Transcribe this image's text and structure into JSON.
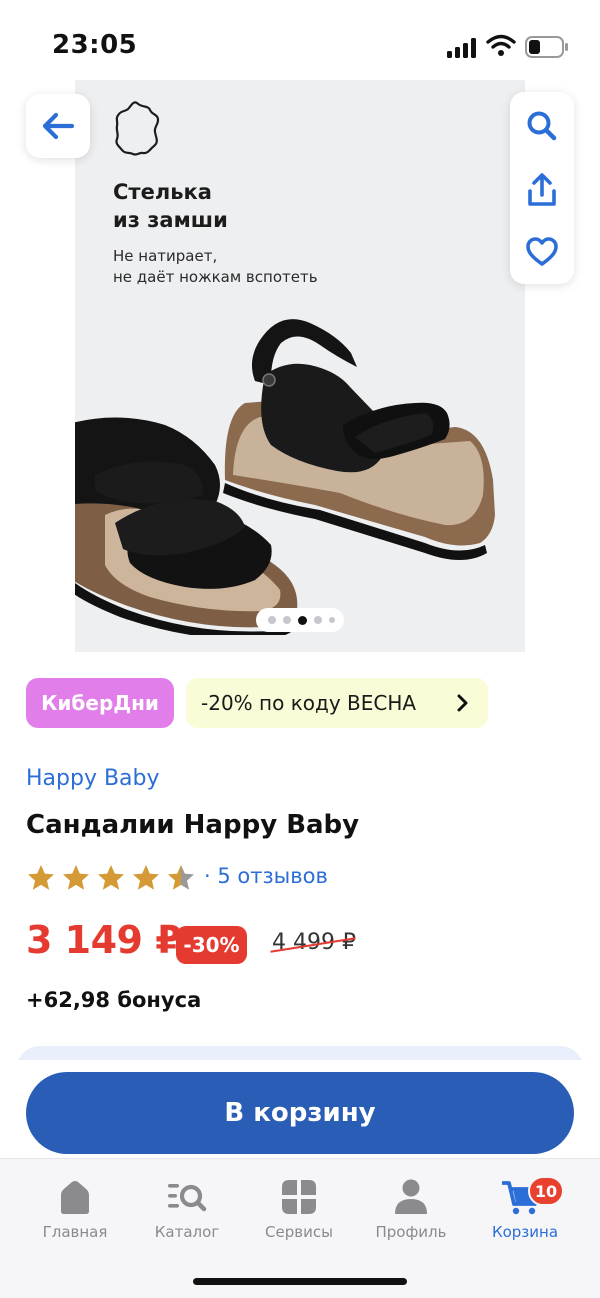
{
  "status_bar": {
    "time": "23:05"
  },
  "gallery": {
    "promo_title_lines": [
      "Стелька",
      "из замши"
    ],
    "promo_subtitle_lines": [
      "Не натирает,",
      "не даёт ножкам вспотеть"
    ],
    "slide_count": 5,
    "active_slide": 3
  },
  "icons": {
    "back": "arrow-left-icon",
    "search": "search-icon",
    "share": "share-icon",
    "favorite": "heart-icon"
  },
  "promos": {
    "cyber_label": "КиберДни",
    "code_label": "-20% по коду ВЕСНА"
  },
  "product": {
    "brand": "Happy Baby",
    "title": "Сандалии Happy Baby",
    "rating": 4.5,
    "reviews_label": "· 5 отзывов",
    "price": "3 149 ₽",
    "discount": "-30%",
    "old_price": "4 499 ₽",
    "bonus": "+62,98 бонуса"
  },
  "cta": {
    "add_to_cart": "В корзину"
  },
  "tabbar": {
    "items": [
      {
        "label": "Главная",
        "icon": "home-icon"
      },
      {
        "label": "Каталог",
        "icon": "catalog-search-icon"
      },
      {
        "label": "Сервисы",
        "icon": "services-grid-icon"
      },
      {
        "label": "Профиль",
        "icon": "profile-icon"
      },
      {
        "label": "Корзина",
        "icon": "cart-icon"
      }
    ],
    "active_index": 4,
    "cart_badge": "10"
  },
  "colors": {
    "accent_blue": "#2c6ed8",
    "button_blue": "#2a5db5",
    "price_red": "#e53a2f",
    "cyber_pink": "#e27ee9",
    "promo_yellow": "#fafbd7"
  }
}
